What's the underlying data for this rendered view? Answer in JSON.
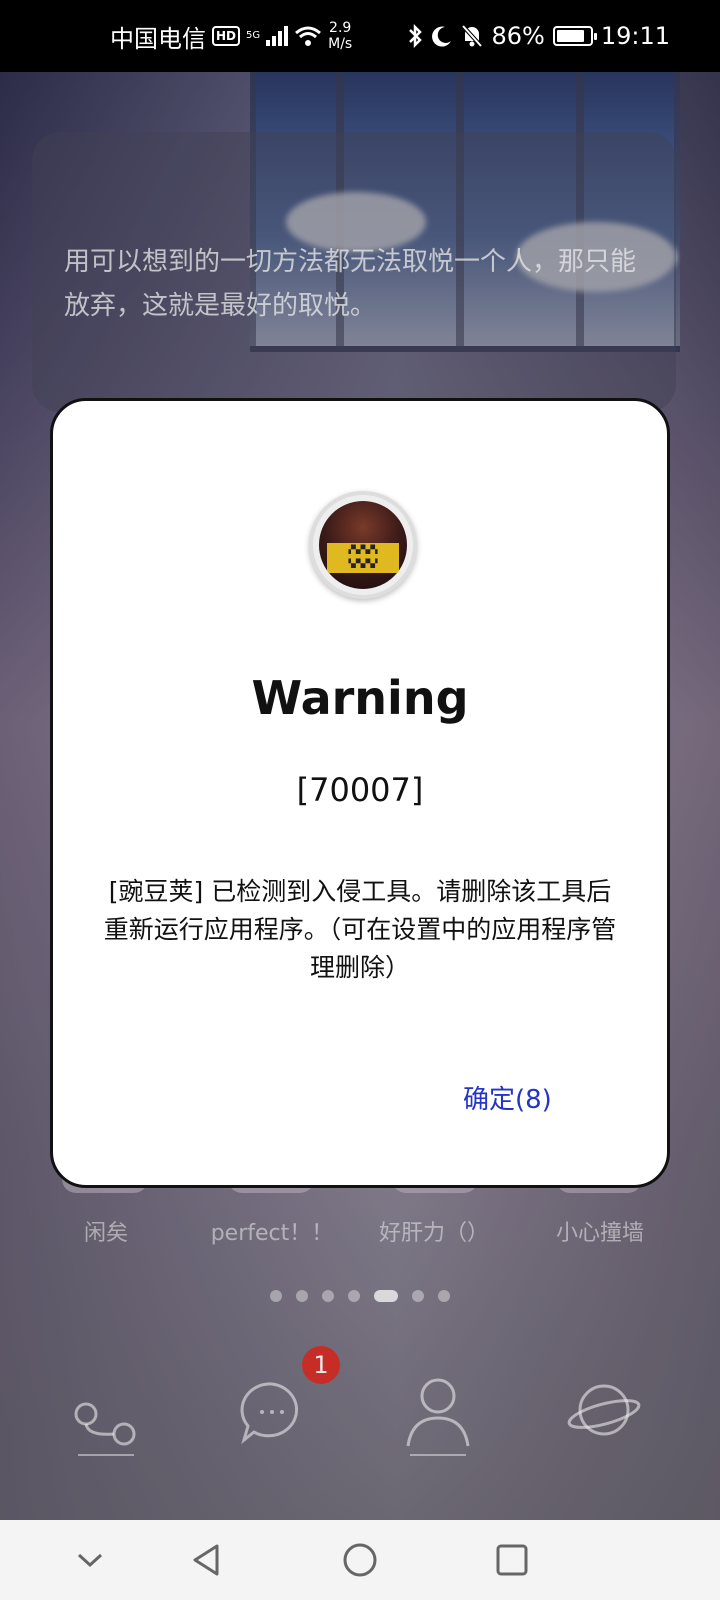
{
  "status_bar": {
    "carrier": "中国电信",
    "hd": "HD",
    "network": "5G",
    "speed_value": "2.9",
    "speed_unit": "M/s",
    "battery_percent": "86%",
    "battery_level": 0.86,
    "time": "19:11"
  },
  "wallpaper": {
    "quote": "用可以想到的一切方法都无法取悦一个人，那只能放弃，这就是最好的取悦。"
  },
  "folders": [
    {
      "label": "闲矣"
    },
    {
      "label": "perfect！！"
    },
    {
      "label": "好肝力（）"
    },
    {
      "label": "小心撞墙"
    }
  ],
  "dock": {
    "messages_badge": "1"
  },
  "dialog": {
    "title": "Warning",
    "code": "[70007]",
    "message": "[豌豆荚] 已检测到入侵工具。请删除该工具后重新运行应用程序。（可在设置中的应用程序管理删除）",
    "confirm_label": "确定(8)",
    "confirm_color": "#2433c8"
  }
}
